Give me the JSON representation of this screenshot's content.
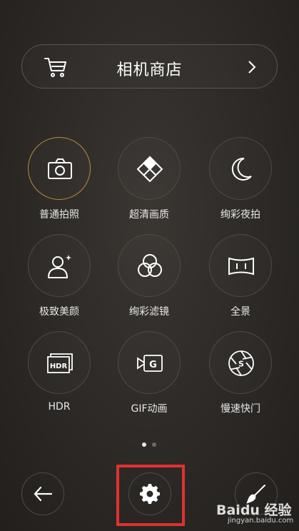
{
  "store": {
    "title": "相机商店",
    "icon": "cart-icon",
    "chevron": "chevron-right-icon"
  },
  "modes": [
    {
      "label": "普通拍照",
      "icon": "camera-icon",
      "active": true
    },
    {
      "label": "超清画质",
      "icon": "diamond-grid-icon",
      "active": false
    },
    {
      "label": "绚彩夜拍",
      "icon": "moon-icon",
      "active": false
    },
    {
      "label": "极致美颜",
      "icon": "portrait-sparkle-icon",
      "active": false
    },
    {
      "label": "绚彩滤镜",
      "icon": "filter-circles-icon",
      "active": false
    },
    {
      "label": "全景",
      "icon": "panorama-icon",
      "active": false
    },
    {
      "label": "HDR",
      "icon": "hdr-icon",
      "active": false
    },
    {
      "label": "GIF动画",
      "icon": "gif-icon",
      "active": false
    },
    {
      "label": "慢速快门",
      "icon": "shutter-icon",
      "active": false
    }
  ],
  "pager": {
    "current": 1,
    "total": 2
  },
  "bottom": {
    "back": "back-arrow-icon",
    "settings": "gear-icon",
    "edit": "brush-icon"
  },
  "watermark": {
    "main": "Baidu 经验",
    "sub": "jingyan.baidu.com"
  },
  "colors": {
    "active_ring": "#b58f3a",
    "highlight": "#e0322f"
  }
}
